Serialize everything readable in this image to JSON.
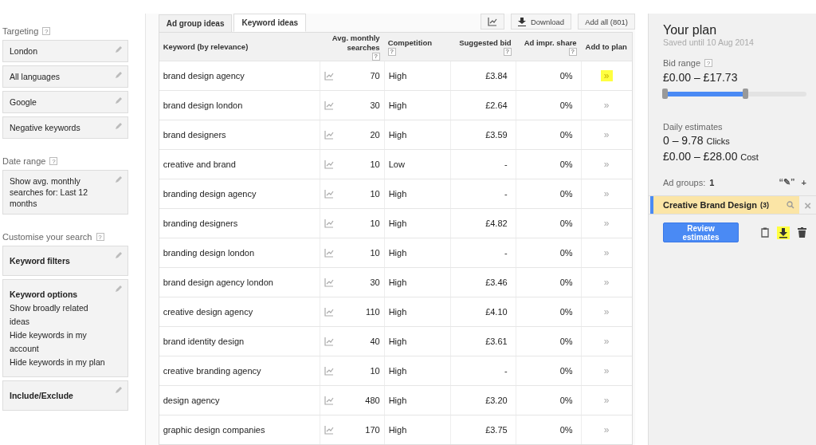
{
  "sidebar": {
    "sections": [
      {
        "title": "Targeting",
        "help": "?",
        "boxes": [
          {
            "kind": "plain",
            "lines": [
              "London"
            ]
          },
          {
            "kind": "plain",
            "lines": [
              "All languages"
            ]
          },
          {
            "kind": "plain",
            "lines": [
              "Google"
            ]
          },
          {
            "kind": "plain",
            "lines": [
              "Negative keywords"
            ]
          }
        ]
      },
      {
        "title": "Date range",
        "help": "?",
        "boxes": [
          {
            "kind": "plain",
            "lines": [
              "Show avg. monthly searches for: Last 12 months"
            ]
          }
        ]
      },
      {
        "title": "Customise your search",
        "help": "?",
        "boxes": [
          {
            "kind": "bold",
            "lines": [
              "Keyword filters"
            ]
          },
          {
            "kind": "bold",
            "lines": [
              "Keyword options",
              "Show broadly related ideas",
              "Hide keywords in my account",
              "Hide keywords in my plan"
            ]
          },
          {
            "kind": "bold",
            "lines": [
              "Include/Exclude"
            ]
          }
        ]
      }
    ]
  },
  "tabs": [
    {
      "label": "Ad group ideas",
      "selected": false
    },
    {
      "label": "Keyword ideas",
      "selected": true
    }
  ],
  "toolbar": {
    "download": "Download",
    "add_all": "Add all (801)"
  },
  "table": {
    "columns": [
      {
        "label": "Keyword (by relevance)"
      },
      {
        "label": "Avg. monthly searches",
        "help": "?"
      },
      {
        "label": "Competition",
        "help": "?"
      },
      {
        "label": "Suggested bid",
        "help": "?"
      },
      {
        "label": "Ad impr. share",
        "help": "?"
      },
      {
        "label": "Add to plan"
      }
    ],
    "rows": [
      {
        "keyword": "brand design agency",
        "searches": "70",
        "competition": "High",
        "bid": "£3.84",
        "share": "0%",
        "add": "»",
        "highlighted": true
      },
      {
        "keyword": "brand design london",
        "searches": "30",
        "competition": "High",
        "bid": "£2.64",
        "share": "0%",
        "add": "»",
        "highlighted": false
      },
      {
        "keyword": "brand designers",
        "searches": "20",
        "competition": "High",
        "bid": "£3.59",
        "share": "0%",
        "add": "»",
        "highlighted": false
      },
      {
        "keyword": "creative and brand",
        "searches": "10",
        "competition": "Low",
        "bid": "-",
        "share": "0%",
        "add": "»",
        "highlighted": false
      },
      {
        "keyword": "branding design agency",
        "searches": "10",
        "competition": "High",
        "bid": "-",
        "share": "0%",
        "add": "»",
        "highlighted": false
      },
      {
        "keyword": "branding designers",
        "searches": "10",
        "competition": "High",
        "bid": "£4.82",
        "share": "0%",
        "add": "»",
        "highlighted": false
      },
      {
        "keyword": "branding design london",
        "searches": "10",
        "competition": "High",
        "bid": "-",
        "share": "0%",
        "add": "»",
        "highlighted": false
      },
      {
        "keyword": "brand design agency london",
        "searches": "30",
        "competition": "High",
        "bid": "£3.46",
        "share": "0%",
        "add": "»",
        "highlighted": false
      },
      {
        "keyword": "creative design agency",
        "searches": "110",
        "competition": "High",
        "bid": "£4.10",
        "share": "0%",
        "add": "»",
        "highlighted": false
      },
      {
        "keyword": "brand identity design",
        "searches": "40",
        "competition": "High",
        "bid": "£3.61",
        "share": "0%",
        "add": "»",
        "highlighted": false
      },
      {
        "keyword": "creative branding agency",
        "searches": "10",
        "competition": "High",
        "bid": "-",
        "share": "0%",
        "add": "»",
        "highlighted": false
      },
      {
        "keyword": "design agency",
        "searches": "480",
        "competition": "High",
        "bid": "£3.20",
        "share": "0%",
        "add": "»",
        "highlighted": false
      },
      {
        "keyword": "graphic design companies",
        "searches": "170",
        "competition": "High",
        "bid": "£3.75",
        "share": "0%",
        "add": "»",
        "highlighted": false
      }
    ]
  },
  "plan": {
    "title": "Your plan",
    "saved": "Saved until 10 Aug 2014",
    "bid_label": "Bid range",
    "bid_help": "?",
    "bid_range": "£0.00 – £17.73",
    "slider": {
      "level": 0.57
    },
    "daily_label": "Daily estimates",
    "clicks_value": "0 – 9.78",
    "clicks_unit": "Clicks",
    "cost_value": "£0.00 – £28.00",
    "cost_unit": "Cost",
    "ad_groups_label": "Ad groups:",
    "ad_groups_count": "1",
    "edit_mark": "“✎”",
    "add_mark": "+",
    "group": {
      "name": "Creative Brand Design",
      "count": "(3)",
      "close": "×"
    },
    "review": "Review estimates",
    "download_highlighted": true
  }
}
